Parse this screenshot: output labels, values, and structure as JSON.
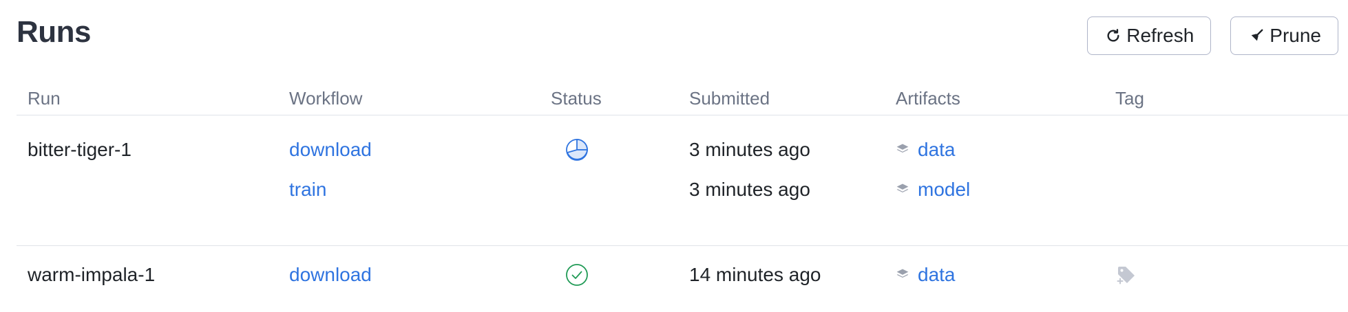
{
  "page": {
    "title": "Runs"
  },
  "toolbar": {
    "refresh_label": "Refresh",
    "prune_label": "Prune"
  },
  "table": {
    "columns": [
      "Run",
      "Workflow",
      "Status",
      "Submitted",
      "Artifacts",
      "Tag"
    ],
    "runs": [
      {
        "name": "bitter-tiger-1",
        "status_icon": "pie-progress-icon",
        "steps": [
          {
            "workflow": "download",
            "submitted": "3 minutes ago",
            "artifact": "data"
          },
          {
            "workflow": "train",
            "submitted": "3 minutes ago",
            "artifact": "model"
          }
        ]
      },
      {
        "name": "warm-impala-1",
        "status_icon": "check-circle-icon",
        "tag_icon": "add-tag-icon",
        "steps": [
          {
            "workflow": "download",
            "submitted": "14 minutes ago",
            "artifact": "data"
          }
        ]
      }
    ]
  },
  "colors": {
    "link": "#2f74e0",
    "success": "#1f9a55",
    "border": "#dfe2e8",
    "header_text": "#6b7384",
    "icon_gray": "#9aa0ad"
  }
}
